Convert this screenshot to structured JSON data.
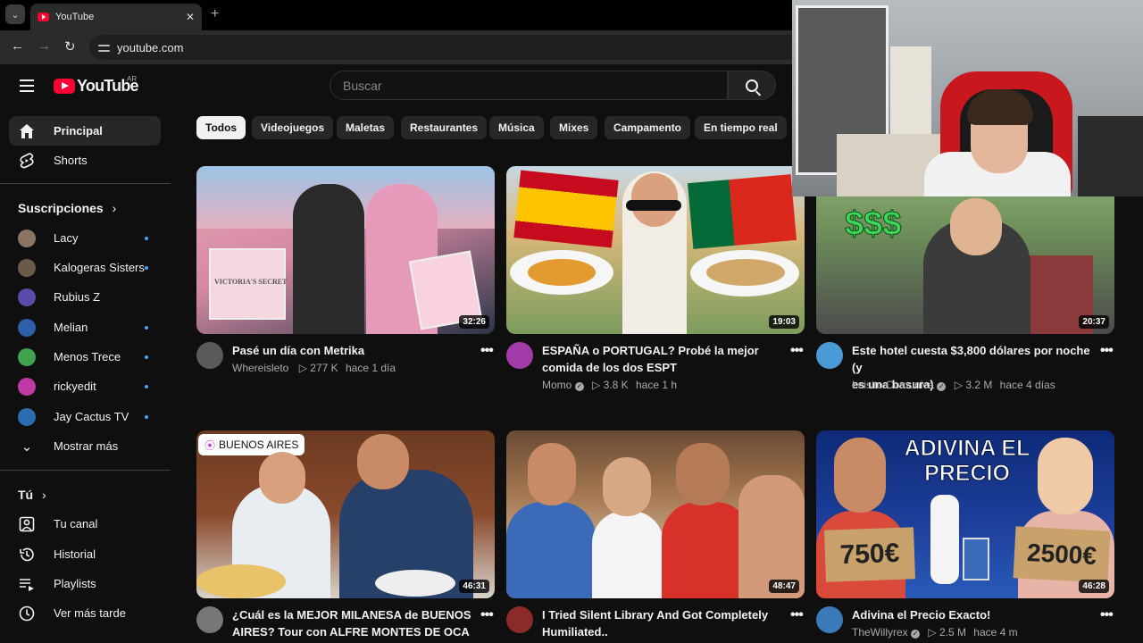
{
  "browser": {
    "tab_title": "YouTube",
    "tab_close": "✕",
    "new_tab": "+",
    "url": "youtube.com"
  },
  "masthead": {
    "logo_text": "YouTube",
    "country": "AR",
    "search_placeholder": "Buscar"
  },
  "sidebar": {
    "main": [
      {
        "label": "Principal",
        "icon": "home-icon"
      },
      {
        "label": "Shorts",
        "icon": "shorts-icon"
      }
    ],
    "subscriptions_heading": "Suscripciones",
    "subscriptions": [
      {
        "label": "Lacy",
        "color": "#8a7565"
      },
      {
        "label": "Kalogeras Sisters",
        "color": "#6b5a4a"
      },
      {
        "label": "Rubius Z",
        "color": "#5b4aa8"
      },
      {
        "label": "Melian",
        "color": "#2f5fa8"
      },
      {
        "label": "Menos Trece",
        "color": "#3fa34d"
      },
      {
        "label": "rickyedit",
        "color": "#c03aa6"
      },
      {
        "label": "Jay Cactus TV",
        "color": "#2c6db0"
      }
    ],
    "show_more": "Mostrar más",
    "you_heading": "Tú",
    "you_items": [
      {
        "label": "Tu canal",
        "icon": "channel-icon"
      },
      {
        "label": "Historial",
        "icon": "history-icon"
      },
      {
        "label": "Playlists",
        "icon": "playlists-icon"
      },
      {
        "label": "Ver más tarde",
        "icon": "watch-later-icon"
      }
    ]
  },
  "chips": [
    "Todos",
    "Videojuegos",
    "Maletas",
    "Restaurantes",
    "Música",
    "Mixes",
    "Campamento",
    "En tiempo real"
  ],
  "videos": [
    {
      "title_lines": [
        "Pasé un día con Metrika",
        ""
      ],
      "channel": "Whereisleto",
      "verified": false,
      "views": "277 K",
      "age": "hace 1 día",
      "duration": "32:26",
      "thumb_colors": [
        "#e9a3b6",
        "#2c3548"
      ],
      "avatar_color": "#5a5a5a",
      "overlay": "VICTORIA'S SECRET"
    },
    {
      "title_lines": [
        "ESPAÑA o PORTUGAL? Probé la mejor",
        "comida de los dos ESPT"
      ],
      "channel": "Momo",
      "verified": true,
      "views": "3.8 K",
      "age": "hace 1 h",
      "duration": "19:03",
      "thumb_colors": [
        "#e4c78a",
        "#7b9c5d"
      ],
      "avatar_color": "#a23ca8",
      "overlay": ""
    },
    {
      "title_lines": [
        "Este hotel cuesta $3,800 dólares por noche (y",
        "es una basura)"
      ],
      "channel": "Luisito Comunica",
      "verified": true,
      "views": "3.2 M",
      "age": "hace 4 días",
      "duration": "20:37",
      "thumb_colors": [
        "#6d8e5a",
        "#3b3b3b"
      ],
      "avatar_color": "#4a9ad6",
      "overlay": "$$$"
    },
    {
      "title_lines": [
        "¿Cuál es la MEJOR MILANESA de BUENOS",
        "AIRES? Tour con ALFRE MONTES DE OCA"
      ],
      "channel": "",
      "verified": false,
      "views": "",
      "age": "",
      "duration": "46:31",
      "thumb_colors": [
        "#8a4a2c",
        "#3a3a5a"
      ],
      "avatar_color": "#777777",
      "overlay": "BUENOS AIRES"
    },
    {
      "title_lines": [
        "I Tried Silent Library And Got Completely",
        "Humiliated.."
      ],
      "channel": "",
      "verified": false,
      "views": "",
      "age": "",
      "duration": "48:47",
      "thumb_colors": [
        "#3a6ab8",
        "#c93a2e"
      ],
      "avatar_color": "#8a2a2a",
      "overlay": ""
    },
    {
      "title_lines": [
        "Adivina el Precio Exacto!",
        ""
      ],
      "channel": "TheWillyrex",
      "verified": true,
      "views": "2.5 M",
      "age": "hace 4 m",
      "duration": "46:28",
      "thumb_colors": [
        "#1d3f9a",
        "#d94a3a"
      ],
      "avatar_color": "#3a7ab8",
      "overlay": "ADIVINA EL PRECIO",
      "price_left": "750€",
      "price_right": "2500€"
    }
  ]
}
